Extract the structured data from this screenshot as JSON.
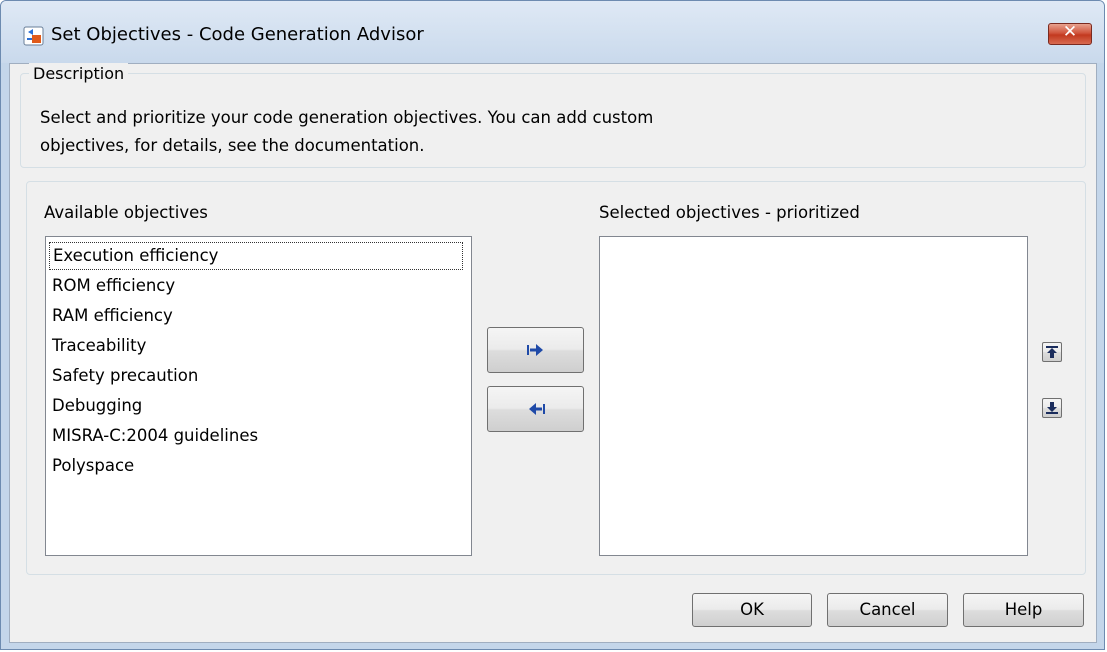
{
  "window": {
    "title": "Set Objectives - Code Generation Advisor",
    "app_icon": "simulink-icon",
    "close_icon": "close-icon",
    "close_color": "#c7452b"
  },
  "description": {
    "legend": "Description",
    "line1": "Select and prioritize your code generation objectives. You can add custom",
    "line2": "objectives, for details, see the documentation."
  },
  "available": {
    "label": "Available objectives",
    "items": [
      "Execution efficiency",
      "ROM efficiency",
      "RAM efficiency",
      "Traceability",
      "Safety precaution",
      "Debugging",
      "MISRA-C:2004 guidelines",
      "Polyspace"
    ],
    "focused_item": "Execution efficiency"
  },
  "selected": {
    "label": "Selected objectives - prioritized",
    "items": []
  },
  "transfer": {
    "add_icon": "arrow-right-icon",
    "remove_icon": "arrow-left-icon",
    "icon_color": "#1f4aa8"
  },
  "priority": {
    "up_icon": "move-up-icon",
    "down_icon": "move-down-icon"
  },
  "buttons": {
    "ok": "OK",
    "cancel": "Cancel",
    "help": "Help"
  }
}
